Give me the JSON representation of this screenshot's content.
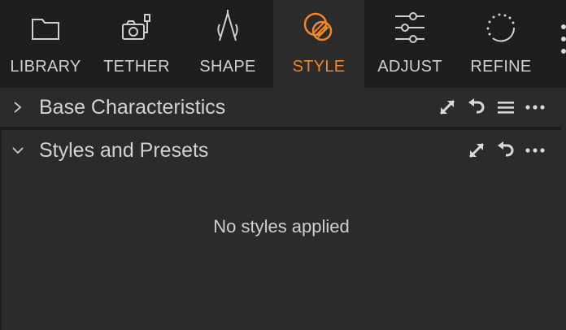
{
  "tabs": [
    {
      "label": "LIBRARY",
      "icon": "folder-icon"
    },
    {
      "label": "TETHER",
      "icon": "tether-camera-icon"
    },
    {
      "label": "SHAPE",
      "icon": "shape-compass-icon"
    },
    {
      "label": "STYLE",
      "icon": "style-circles-icon",
      "active": true
    },
    {
      "label": "ADJUST",
      "icon": "sliders-icon"
    },
    {
      "label": "REFINE",
      "icon": "refine-dotted-circle-icon"
    }
  ],
  "sections": {
    "base": {
      "title": "Base Characteristics",
      "expanded": false
    },
    "styles": {
      "title": "Styles and Presets",
      "expanded": true
    }
  },
  "styles_empty_message": "No styles applied",
  "colors": {
    "accent": "#f0852a",
    "tabbar_bg": "#1e1e1e",
    "panel_bg": "#2b2b2b"
  }
}
